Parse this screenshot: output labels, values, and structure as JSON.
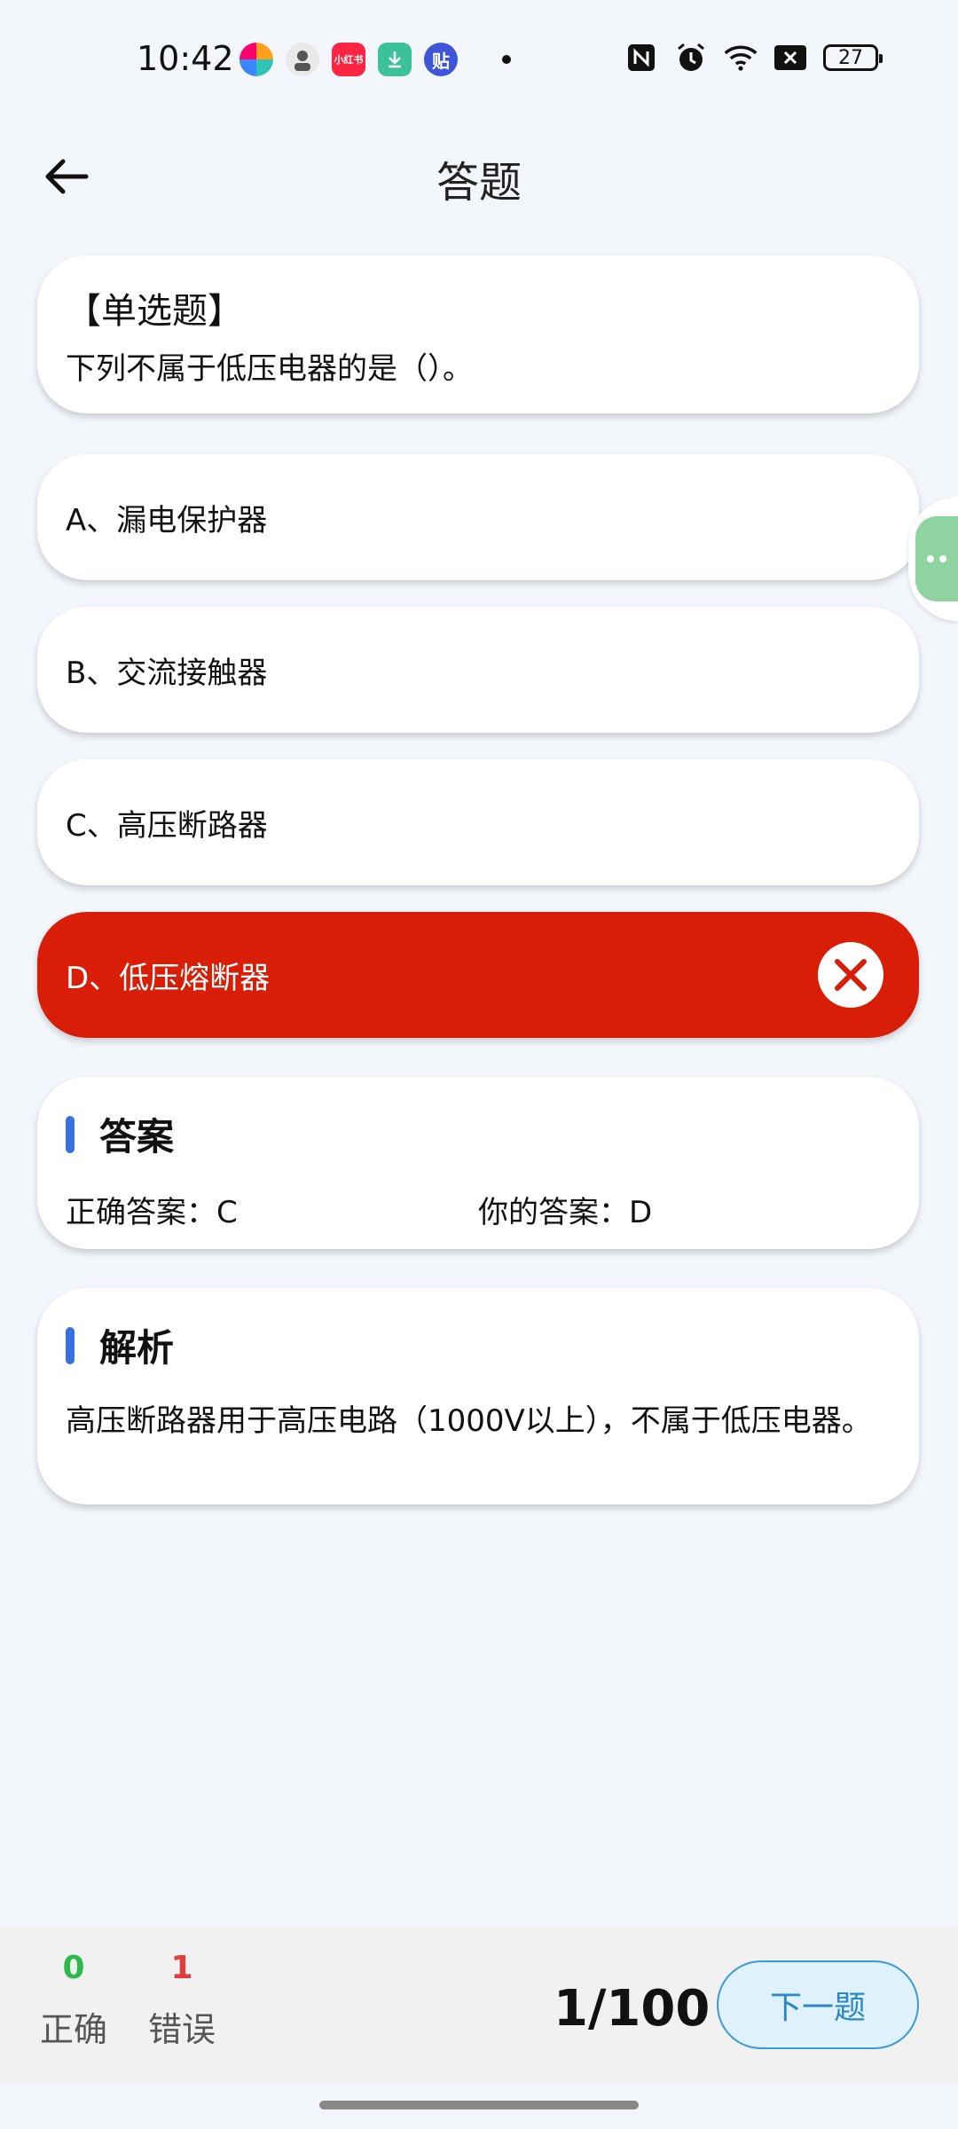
{
  "status_bar": {
    "time": "10:42",
    "battery": "27",
    "apps": [
      {
        "name": "colorful-app-icon",
        "color": "#ff9f1c"
      },
      {
        "name": "avatar-app-icon",
        "color": "#cccccc"
      },
      {
        "name": "xiaohongshu-app-icon",
        "color": "#ff2442",
        "text": "小红书"
      },
      {
        "name": "download-app-icon",
        "color": "#3cc29b"
      },
      {
        "name": "tieba-app-icon",
        "color": "#3d55d6",
        "text": "贴"
      }
    ]
  },
  "header": {
    "title": "答题"
  },
  "question": {
    "type": "【单选题】",
    "text": "下列不属于低压电器的是（）。"
  },
  "options": [
    {
      "label": "A、漏电保护器"
    },
    {
      "label": "B、交流接触器"
    },
    {
      "label": "C、高压断路器"
    },
    {
      "label": "D、低压熔断器",
      "state": "wrong"
    }
  ],
  "answer": {
    "title": "答案",
    "correct": "正确答案：C",
    "yours": "你的答案：D"
  },
  "analysis": {
    "title": "解析",
    "text": "高压断路器用于高压电路（1000V以上），不属于低压电器。"
  },
  "bottom": {
    "correct_count": "0",
    "correct_label": "正确",
    "wrong_count": "1",
    "wrong_label": "错误",
    "progress": "1/100",
    "next_label": "下一题"
  },
  "colors": {
    "wrong": "#d81e06",
    "accent": "#3a6fe0",
    "correct_stat": "#2db84c",
    "wrong_stat": "#e23b3b",
    "next_button_bg": "#dff1fd"
  }
}
